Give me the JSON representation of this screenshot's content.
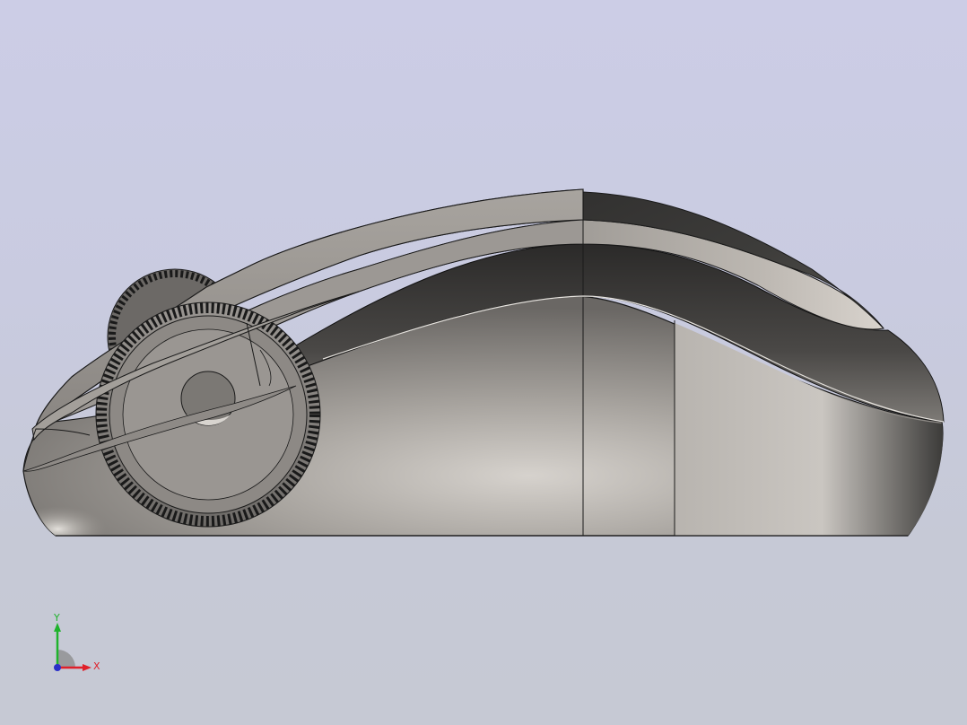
{
  "viewport": {
    "background_top": "#cccde6",
    "background_bottom": "#c6c9d4"
  },
  "model": {
    "body_color": "#8f8b87",
    "dark_color": "#2f2f2d",
    "edge_color": "#1a1a1a"
  },
  "triad": {
    "x_label": "X",
    "y_label": "Y",
    "x_color": "#e0202a",
    "y_color": "#1fb32c",
    "z_color": "#2a30c8"
  }
}
